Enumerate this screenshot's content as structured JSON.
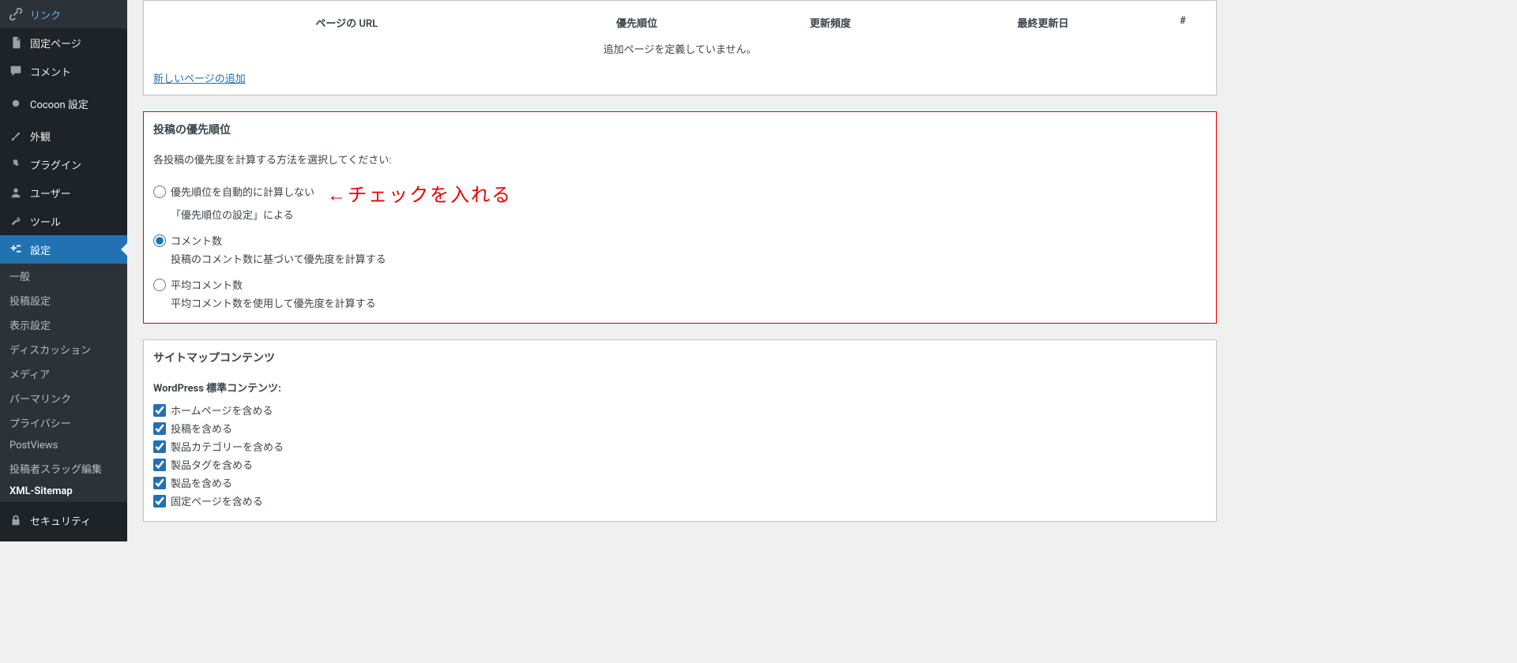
{
  "sidebar": {
    "link": "リンク",
    "pages": "固定ページ",
    "comments": "コメント",
    "cocoon": "Cocoon 設定",
    "appearance": "外観",
    "plugins": "プラグイン",
    "users": "ユーザー",
    "tools": "ツール",
    "settings": "設定",
    "security": "セキュリティ",
    "submenu": {
      "general": "一般",
      "writing": "投稿設定",
      "reading": "表示設定",
      "discussion": "ディスカッション",
      "media": "メディア",
      "permalink": "パーマリンク",
      "privacy": "プライバシー",
      "postviews": "PostViews",
      "slug": "投稿者スラッグ編集",
      "xml": "XML-Sitemap"
    }
  },
  "table": {
    "url": "ページの URL",
    "priority": "優先順位",
    "freq": "更新頻度",
    "last": "最終更新日",
    "hash": "#",
    "empty": "追加ページを定義していません。",
    "add_link": "新しいページの追加"
  },
  "priority": {
    "title": "投稿の優先順位",
    "desc": "各投稿の優先度を計算する方法を選択してください:",
    "opt1_label": "優先順位を自動的に計算しない",
    "opt1_desc": "「優先順位の設定」による",
    "opt2_label": "コメント数",
    "opt2_desc": "投稿のコメント数に基づいて優先度を計算する",
    "opt3_label": "平均コメント数",
    "opt3_desc": "平均コメント数を使用して優先度を計算する",
    "annotation": "←チェックを入れる"
  },
  "sitemap": {
    "title": "サイトマップコンテンツ",
    "subtitle": "WordPress 標準コンテンツ:",
    "chk1": "ホームページを含める",
    "chk2": "投稿を含める",
    "chk3": "製品カテゴリーを含める",
    "chk4": "製品タグを含める",
    "chk5": "製品を含める",
    "chk6": "固定ページを含める"
  }
}
